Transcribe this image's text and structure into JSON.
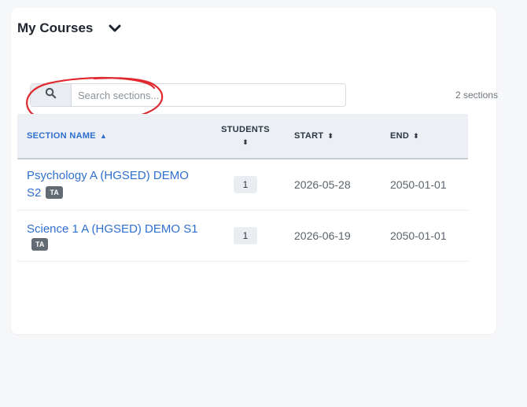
{
  "header": {
    "title": "My Courses"
  },
  "search": {
    "placeholder": "Search sections..."
  },
  "section_count": "2 sections",
  "table": {
    "columns": {
      "name": "SECTION NAME",
      "students": "STUDENTS",
      "start": "START",
      "end": "END"
    },
    "rows": [
      {
        "name": "Psychology A (HGSED) DEMO S2",
        "role": "TA",
        "students": "1",
        "start": "2026-05-28",
        "end": "2050-01-01"
      },
      {
        "name": "Science 1 A (HGSED) DEMO S1",
        "role": "TA",
        "students": "1",
        "start": "2026-06-19",
        "end": "2050-01-01"
      }
    ]
  },
  "colors": {
    "link": "#2f6fd0",
    "annotation": "#e0282e",
    "badge": "#626a73"
  }
}
